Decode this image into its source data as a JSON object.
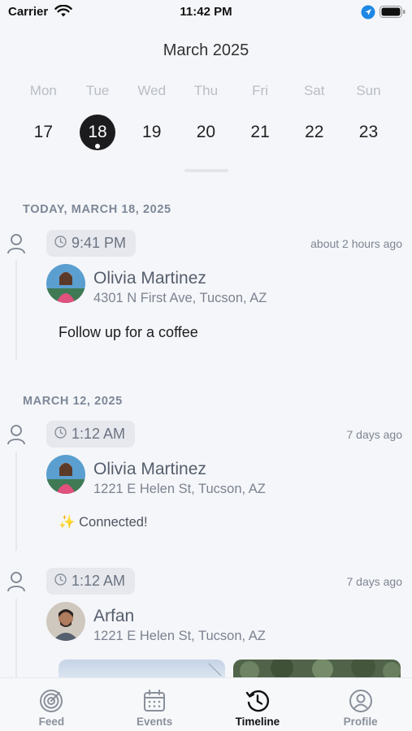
{
  "status_bar": {
    "carrier": "Carrier",
    "time": "11:42 PM"
  },
  "calendar": {
    "month": "March 2025",
    "days": [
      {
        "name": "Mon",
        "num": "17"
      },
      {
        "name": "Tue",
        "num": "18",
        "selected": true
      },
      {
        "name": "Wed",
        "num": "19"
      },
      {
        "name": "Thu",
        "num": "20"
      },
      {
        "name": "Fri",
        "num": "21"
      },
      {
        "name": "Sat",
        "num": "22"
      },
      {
        "name": "Sun",
        "num": "23"
      }
    ]
  },
  "timeline": {
    "sections": [
      {
        "header": "TODAY, MARCH 18, 2025",
        "entries": [
          {
            "time": "9:41 PM",
            "ago": "about 2 hours ago",
            "name": "Olivia Martinez",
            "address": "4301 N First Ave, Tucson, AZ",
            "note": "Follow up for a coffee"
          }
        ]
      },
      {
        "header": "MARCH 12, 2025",
        "entries": [
          {
            "time": "1:12 AM",
            "ago": "7 days ago",
            "name": "Olivia Martinez",
            "address": "1221 E Helen St, Tucson, AZ",
            "note": "✨ Connected!"
          },
          {
            "time": "1:12 AM",
            "ago": "7 days ago",
            "name": "Arfan",
            "address": "1221 E Helen St, Tucson, AZ"
          }
        ]
      }
    ]
  },
  "tabs": [
    {
      "label": "Feed",
      "icon": "feed-radar-icon"
    },
    {
      "label": "Events",
      "icon": "calendar-icon"
    },
    {
      "label": "Timeline",
      "icon": "history-clock-icon",
      "active": true
    },
    {
      "label": "Profile",
      "icon": "profile-icon"
    }
  ],
  "colors": {
    "accent": "#1c1c1e",
    "section_header": "#7c8797",
    "location_blue": "#1e88e5"
  }
}
